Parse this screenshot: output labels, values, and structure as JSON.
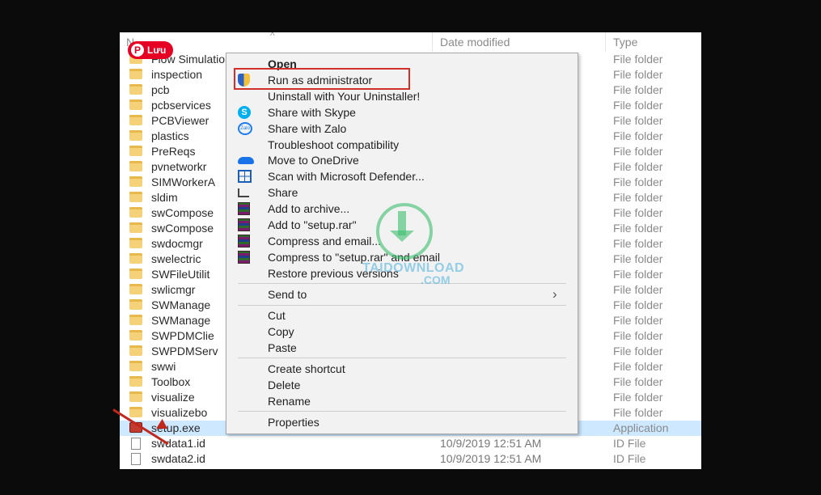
{
  "pin_button": {
    "label": "Lưu"
  },
  "columns": {
    "name_initial": "N",
    "date_modified": "Date modified",
    "type": "Type"
  },
  "files": [
    {
      "name": "Flow Simulation",
      "date": "",
      "type": "File folder",
      "kind": "folder"
    },
    {
      "name": "inspection",
      "date": "",
      "type": "File folder",
      "kind": "folder"
    },
    {
      "name": "pcb",
      "date": "",
      "type": "File folder",
      "kind": "folder"
    },
    {
      "name": "pcbservices",
      "date": "",
      "type": "File folder",
      "kind": "folder"
    },
    {
      "name": "PCBViewer",
      "date": "",
      "type": "File folder",
      "kind": "folder"
    },
    {
      "name": "plastics",
      "date": "",
      "type": "File folder",
      "kind": "folder"
    },
    {
      "name": "PreReqs",
      "date": "",
      "type": "File folder",
      "kind": "folder"
    },
    {
      "name": "pvnetworkr",
      "date": "",
      "type": "File folder",
      "kind": "folder"
    },
    {
      "name": "SIMWorkerA",
      "date": "",
      "type": "File folder",
      "kind": "folder"
    },
    {
      "name": "sldim",
      "date": "",
      "type": "File folder",
      "kind": "folder"
    },
    {
      "name": "swCompose",
      "date": "",
      "type": "File folder",
      "kind": "folder"
    },
    {
      "name": "swCompose",
      "date": "",
      "type": "File folder",
      "kind": "folder"
    },
    {
      "name": "swdocmgr",
      "date": "",
      "type": "File folder",
      "kind": "folder"
    },
    {
      "name": "swelectric",
      "date": "",
      "type": "File folder",
      "kind": "folder"
    },
    {
      "name": "SWFileUtilit",
      "date": "",
      "type": "File folder",
      "kind": "folder"
    },
    {
      "name": "swlicmgr",
      "date": "",
      "type": "File folder",
      "kind": "folder"
    },
    {
      "name": "SWManage",
      "date": "",
      "type": "File folder",
      "kind": "folder"
    },
    {
      "name": "SWManage",
      "date": "",
      "type": "File folder",
      "kind": "folder"
    },
    {
      "name": "SWPDMClie",
      "date": "",
      "type": "File folder",
      "kind": "folder"
    },
    {
      "name": "SWPDMServ",
      "date": "",
      "type": "File folder",
      "kind": "folder"
    },
    {
      "name": "swwi",
      "date": "",
      "type": "File folder",
      "kind": "folder"
    },
    {
      "name": "Toolbox",
      "date": "",
      "type": "File folder",
      "kind": "folder"
    },
    {
      "name": "visualize",
      "date": "",
      "type": "File folder",
      "kind": "folder"
    },
    {
      "name": "visualizebo",
      "date": "",
      "type": "File folder",
      "kind": "folder"
    },
    {
      "name": "setup.exe",
      "date": "",
      "type": "Application",
      "kind": "app",
      "selected": true
    },
    {
      "name": "swdata1.id",
      "date": "10/9/2019 12:51 AM",
      "type": "ID File",
      "kind": "file"
    },
    {
      "name": "swdata2.id",
      "date": "10/9/2019 12:51 AM",
      "type": "ID File",
      "kind": "file"
    }
  ],
  "context_menu": {
    "items": [
      {
        "label": "Open",
        "bold": true,
        "icon": "none"
      },
      {
        "label": "Run as administrator",
        "icon": "shield-icon",
        "highlighted": true
      },
      {
        "label": "Uninstall with Your Uninstaller!",
        "icon": "none"
      },
      {
        "label": "Share with Skype",
        "icon": "skype-icon"
      },
      {
        "label": "Share with Zalo",
        "icon": "zalo-icon"
      },
      {
        "label": "Troubleshoot compatibility",
        "icon": "none"
      },
      {
        "label": "Move to OneDrive",
        "icon": "onedrive-icon"
      },
      {
        "label": "Scan with Microsoft Defender...",
        "icon": "defender-icon"
      },
      {
        "label": "Share",
        "icon": "share-icon"
      },
      {
        "label": "Add to archive...",
        "icon": "winrar-icon"
      },
      {
        "label": "Add to \"setup.rar\"",
        "icon": "winrar-icon"
      },
      {
        "label": "Compress and email...",
        "icon": "winrar-icon"
      },
      {
        "label": "Compress to \"setup.rar\" and email",
        "icon": "winrar-icon"
      },
      {
        "label": "Restore previous versions",
        "icon": "none"
      },
      {
        "label": "Send to",
        "icon": "none",
        "submenu": true
      },
      {
        "label": "Cut",
        "icon": "none"
      },
      {
        "label": "Copy",
        "icon": "none"
      },
      {
        "label": "Paste",
        "icon": "none"
      },
      {
        "label": "Create shortcut",
        "icon": "none"
      },
      {
        "label": "Delete",
        "icon": "none"
      },
      {
        "label": "Rename",
        "icon": "none"
      },
      {
        "label": "Properties",
        "icon": "none"
      }
    ]
  },
  "watermark": {
    "text": "TAIDOWNLOAD",
    "sub": ".COM"
  },
  "colors": {
    "highlight_border": "#d0302a",
    "selection": "#cde8ff",
    "menu_bg": "#f2f2f2",
    "pin_red": "#e60023"
  }
}
